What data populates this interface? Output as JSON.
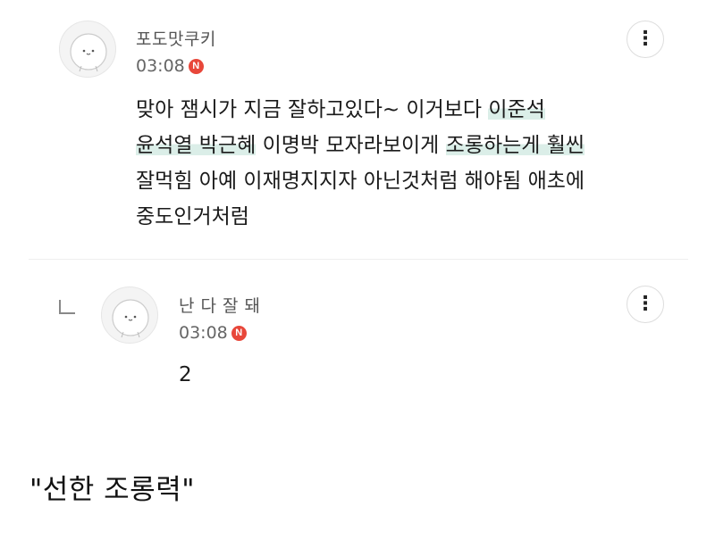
{
  "comments": [
    {
      "nickname": "포도맛쿠키",
      "time": "03:08",
      "badge": "N",
      "lines": {
        "l1_a": "맞아 잼시가 지금 잘하고있다~ 이거보다 ",
        "l1_hl": "이준석",
        "l2_hl": "윤석열 박근혜",
        "l2_b": " 이명박 모자라보이게 ",
        "l2_hl2": "조롱하는게 훨씬",
        "l3": "잘먹힘 아예 이재명지지자 아닌것처럼 해야됨 애초에",
        "l4": "중도인거처럼"
      }
    },
    {
      "nickname": "난 다 잘 돼",
      "time": "03:08",
      "badge": "N",
      "text": "2"
    }
  ],
  "more_icon": "⋮",
  "caption": "\"선한 조롱력\"",
  "colors": {
    "highlight": "#dbeee8",
    "badge": "#e8473a",
    "divider": "#eeeeee"
  }
}
